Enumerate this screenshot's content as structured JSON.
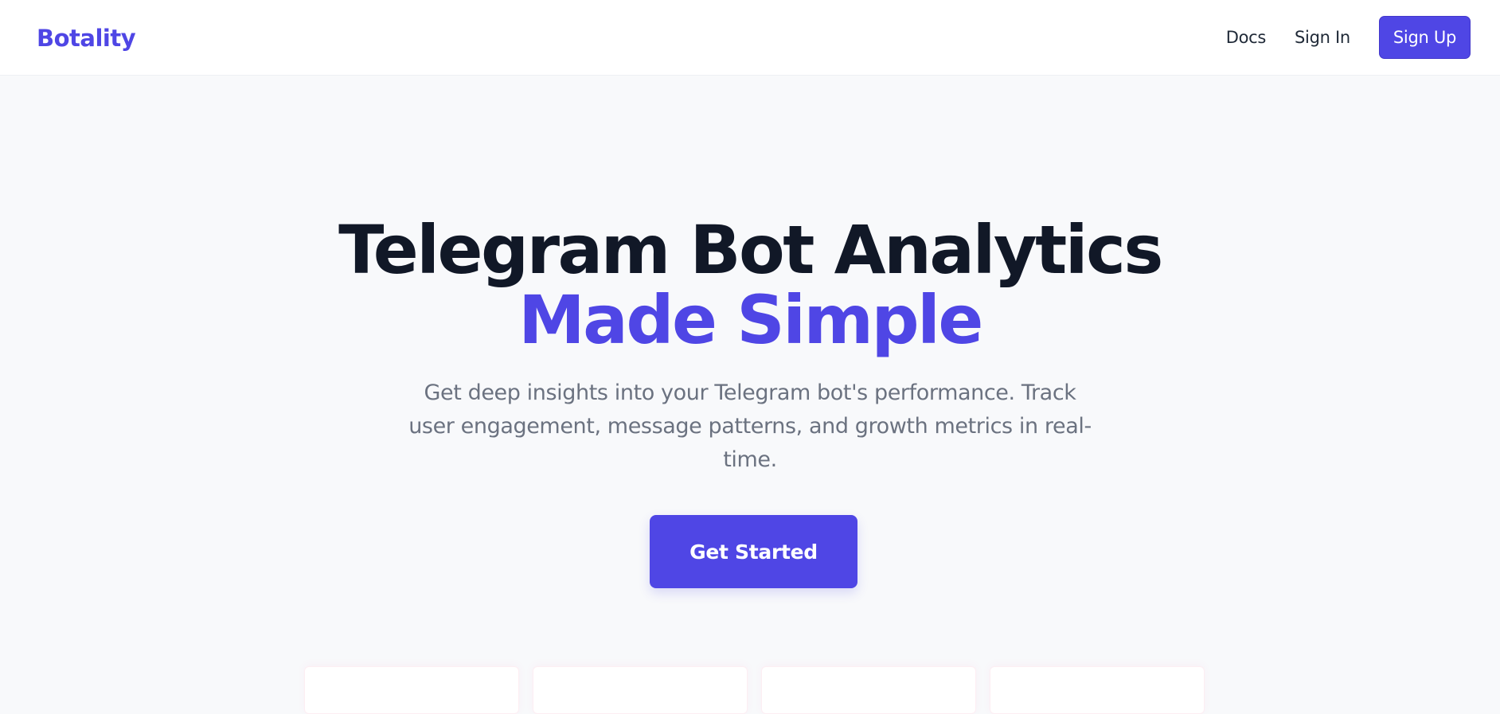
{
  "navbar": {
    "brand": "Botality",
    "links": {
      "docs": "Docs",
      "signin": "Sign In"
    },
    "signup_label": "Sign Up"
  },
  "hero": {
    "title_line1": "Telegram Bot Analytics",
    "title_line2": "Made Simple",
    "subtitle": "Get deep insights into your Telegram bot's performance. Track user engagement, message patterns, and growth metrics in real-time.",
    "cta_label": "Get Started"
  },
  "colors": {
    "accent": "#4f46e5",
    "heading": "#111827",
    "muted_text": "#6b7280",
    "background": "#f8f9fb"
  }
}
